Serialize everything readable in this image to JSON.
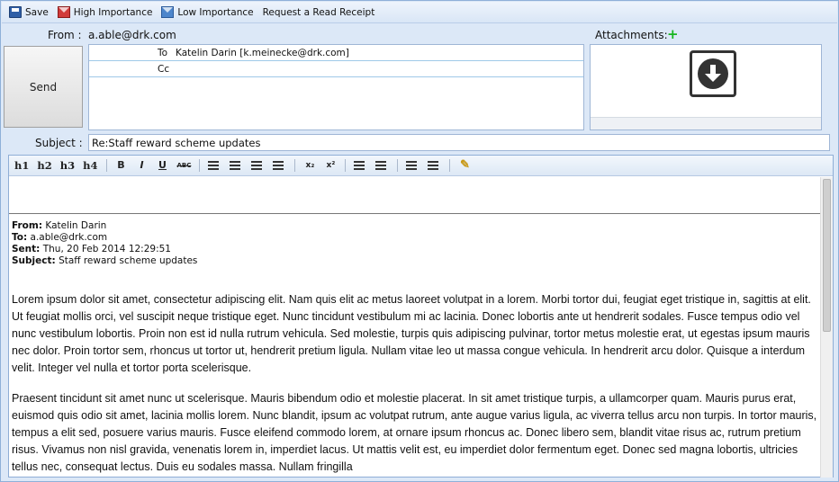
{
  "toolbar": {
    "save_label": "Save",
    "high_importance_label": "High Importance",
    "low_importance_label": "Low Importance",
    "read_receipt_label": "Request a Read Receipt"
  },
  "from": {
    "label": "From :",
    "value": "a.able@drk.com"
  },
  "attachments": {
    "label": "Attachments:"
  },
  "send_label": "Send",
  "recipients": {
    "to_label": "To",
    "to_value": "Katelin Darin [k.meinecke@drk.com]",
    "cc_label": "Cc",
    "cc_value": ""
  },
  "subject": {
    "label": "Subject :",
    "value": "Re:Staff reward scheme updates"
  },
  "editor_toolbar": {
    "h1": "h1",
    "h2": "h2",
    "h3": "h3",
    "h4": "h4",
    "bold": "B",
    "italic": "I",
    "underline": "U",
    "strike": "ABC",
    "subscript": "x₂",
    "superscript": "x²"
  },
  "quoted": {
    "from_label": "From:",
    "from_value": "Katelin Darin",
    "to_label": "To:",
    "to_value": "a.able@drk.com",
    "sent_label": "Sent:",
    "sent_value": "Thu, 20 Feb 2014 12:29:51",
    "subject_label": "Subject:",
    "subject_value": "Staff reward scheme updates"
  },
  "body": {
    "paragraph1": "Lorem ipsum dolor sit amet, consectetur adipiscing elit. Nam quis elit ac metus laoreet volutpat in a lorem. Morbi tortor dui, feugiat eget tristique in, sagittis at elit. Ut feugiat mollis orci, vel suscipit neque tristique eget. Nunc tincidunt vestibulum mi ac lacinia. Donec lobortis ante ut hendrerit sodales. Fusce tempus odio vel nunc vestibulum lobortis. Proin non est id nulla rutrum vehicula. Sed molestie, turpis quis adipiscing pulvinar, tortor metus molestie erat, ut egestas ipsum mauris nec dolor. Proin tortor sem, rhoncus ut tortor ut, hendrerit pretium ligula. Nullam vitae leo ut massa congue vehicula. In hendrerit arcu dolor. Quisque a interdum velit. Integer vel nulla et tortor porta scelerisque.",
    "paragraph2": "Praesent tincidunt sit amet nunc ut scelerisque. Mauris bibendum odio et molestie placerat. In sit amet tristique turpis, a ullamcorper quam. Mauris purus erat, euismod quis odio sit amet, lacinia mollis lorem. Nunc blandit, ipsum ac volutpat rutrum, ante augue varius ligula, ac viverra tellus arcu non turpis. In tortor mauris, tempus a elit sed, posuere varius mauris. Fusce eleifend commodo lorem, at ornare ipsum rhoncus ac. Donec libero sem, blandit vitae risus ac, rutrum pretium risus. Vivamus non nisl gravida, venenatis lorem in, imperdiet lacus. Ut mattis velit est, eu imperdiet dolor fermentum eget. Donec sed magna lobortis, ultricies tellus nec, consequat lectus. Duis eu sodales massa. Nullam fringilla"
  },
  "colors": {
    "accent_green": "#17b51f",
    "frame_blue": "#dce8f7",
    "importance_red": "#d13a3a",
    "importance_blue": "#4d86cc"
  }
}
